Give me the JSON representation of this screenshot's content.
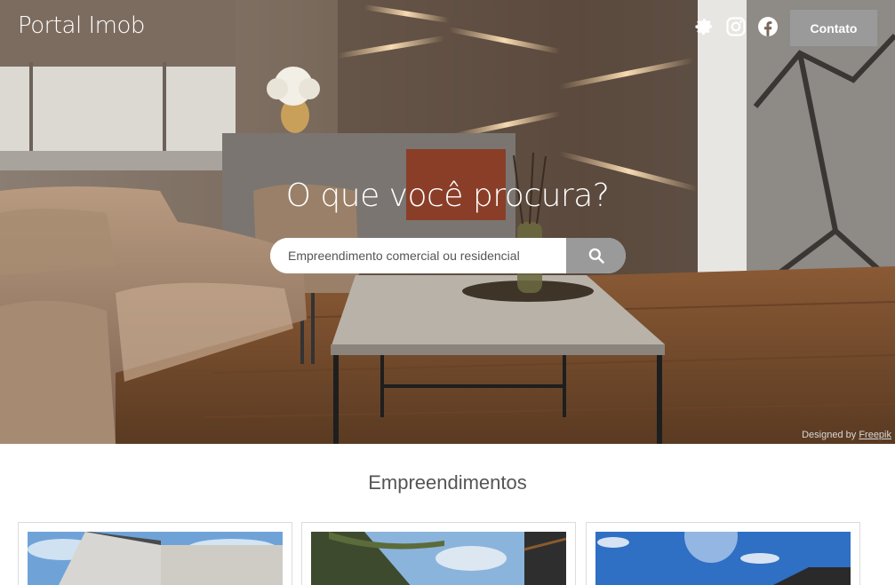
{
  "header": {
    "logo": "Portal Imob",
    "icons": [
      "gear-icon",
      "instagram-icon",
      "facebook-icon"
    ],
    "contact_label": "Contato"
  },
  "hero": {
    "headline": "O que você procura?",
    "search": {
      "placeholder": "Empreendimento comercial ou residencial",
      "value": ""
    },
    "credit_prefix": "Designed by",
    "credit_link": "Freepik"
  },
  "section": {
    "title": "Empreendimentos"
  },
  "colors": {
    "accent_gray": "#9a9a9a",
    "text": "#555555",
    "white": "#ffffff"
  }
}
